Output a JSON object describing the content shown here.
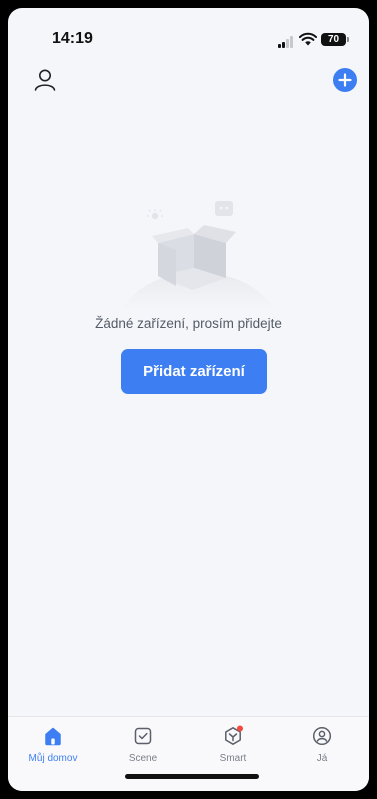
{
  "status_bar": {
    "time": "14:19",
    "battery": "70"
  },
  "top_bar": {
    "profile_icon": "person-icon",
    "add_icon": "plus-icon"
  },
  "empty_state": {
    "illustration": "empty-box-illustration",
    "message": "Žádné zařízení, prosím přidejte",
    "button_label": "Přidat zařízení"
  },
  "tabs": [
    {
      "label": "Můj domov",
      "icon": "home-icon",
      "active": true
    },
    {
      "label": "Scene",
      "icon": "checkbox-icon",
      "active": false
    },
    {
      "label": "Smart",
      "icon": "smart-icon",
      "active": false,
      "badge": true
    },
    {
      "label": "Já",
      "icon": "user-circle-icon",
      "active": false
    }
  ],
  "colors": {
    "accent": "#3d7ff2",
    "badge": "#f04b3e",
    "background": "#f5f6fa"
  }
}
